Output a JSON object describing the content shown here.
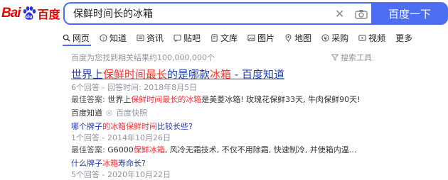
{
  "logo": {
    "part1": "Bai",
    "part2": "百度"
  },
  "search": {
    "value": "保鲜时间长的冰箱",
    "button": "百度一下"
  },
  "tabs": [
    {
      "label": "网页",
      "icon": "search-icon"
    },
    {
      "label": "知道",
      "icon": "question-icon"
    },
    {
      "label": "资讯",
      "icon": "news-icon"
    },
    {
      "label": "贴吧",
      "icon": "tieba-icon"
    },
    {
      "label": "文库",
      "icon": "document-icon"
    },
    {
      "label": "图片",
      "icon": "image-icon"
    },
    {
      "label": "地图",
      "icon": "map-icon"
    },
    {
      "label": "采购",
      "icon": "purchase-icon"
    },
    {
      "label": "视频",
      "icon": "video-icon"
    },
    {
      "label": "更多",
      "icon": ""
    }
  ],
  "result_count": "百度为您找到相关结果约100,000,000个",
  "search_tools": "搜索工具",
  "results": [
    {
      "title_pre": "世界上",
      "title_hl1": "保鲜时间最长",
      "title_mid": "的是哪款",
      "title_hl2": "冰箱",
      "title_post": " - 百度知道",
      "meta": "6个回答 - 回答时间: 2018年8月5日",
      "answer_label": "最佳答案: ",
      "answer_pre": "世界上",
      "answer_hl": "保鲜时间最长的冰箱",
      "answer_post": "是美菱冰箱! 玫瑰花保鲜33天, 牛肉保鲜90天!",
      "source": "百度知道",
      "snapshot": "百度快照"
    },
    {
      "title_pre": "哪个牌子",
      "title_hl": "的冰箱保鲜时间",
      "title_post": "比较长些?",
      "meta": "1个回答 - 2014年10月26日",
      "answer_label": "最佳答案: ",
      "answer_pre": "G6000",
      "answer_hl": "保鲜冰箱",
      "answer_post": ", 风冷无霜技术, 不仅不用除霜, 快速制冷, 并使箱内温..."
    },
    {
      "title_pre": "什么牌子",
      "title_hl": "冰箱",
      "title_post": "寿命长?",
      "meta": "5个回答 - 2020年10月22日"
    }
  ],
  "colors": {
    "accent": "#4e6ef2",
    "link": "#2440b3",
    "highlight": "#f73131",
    "brand": "#e10601"
  }
}
